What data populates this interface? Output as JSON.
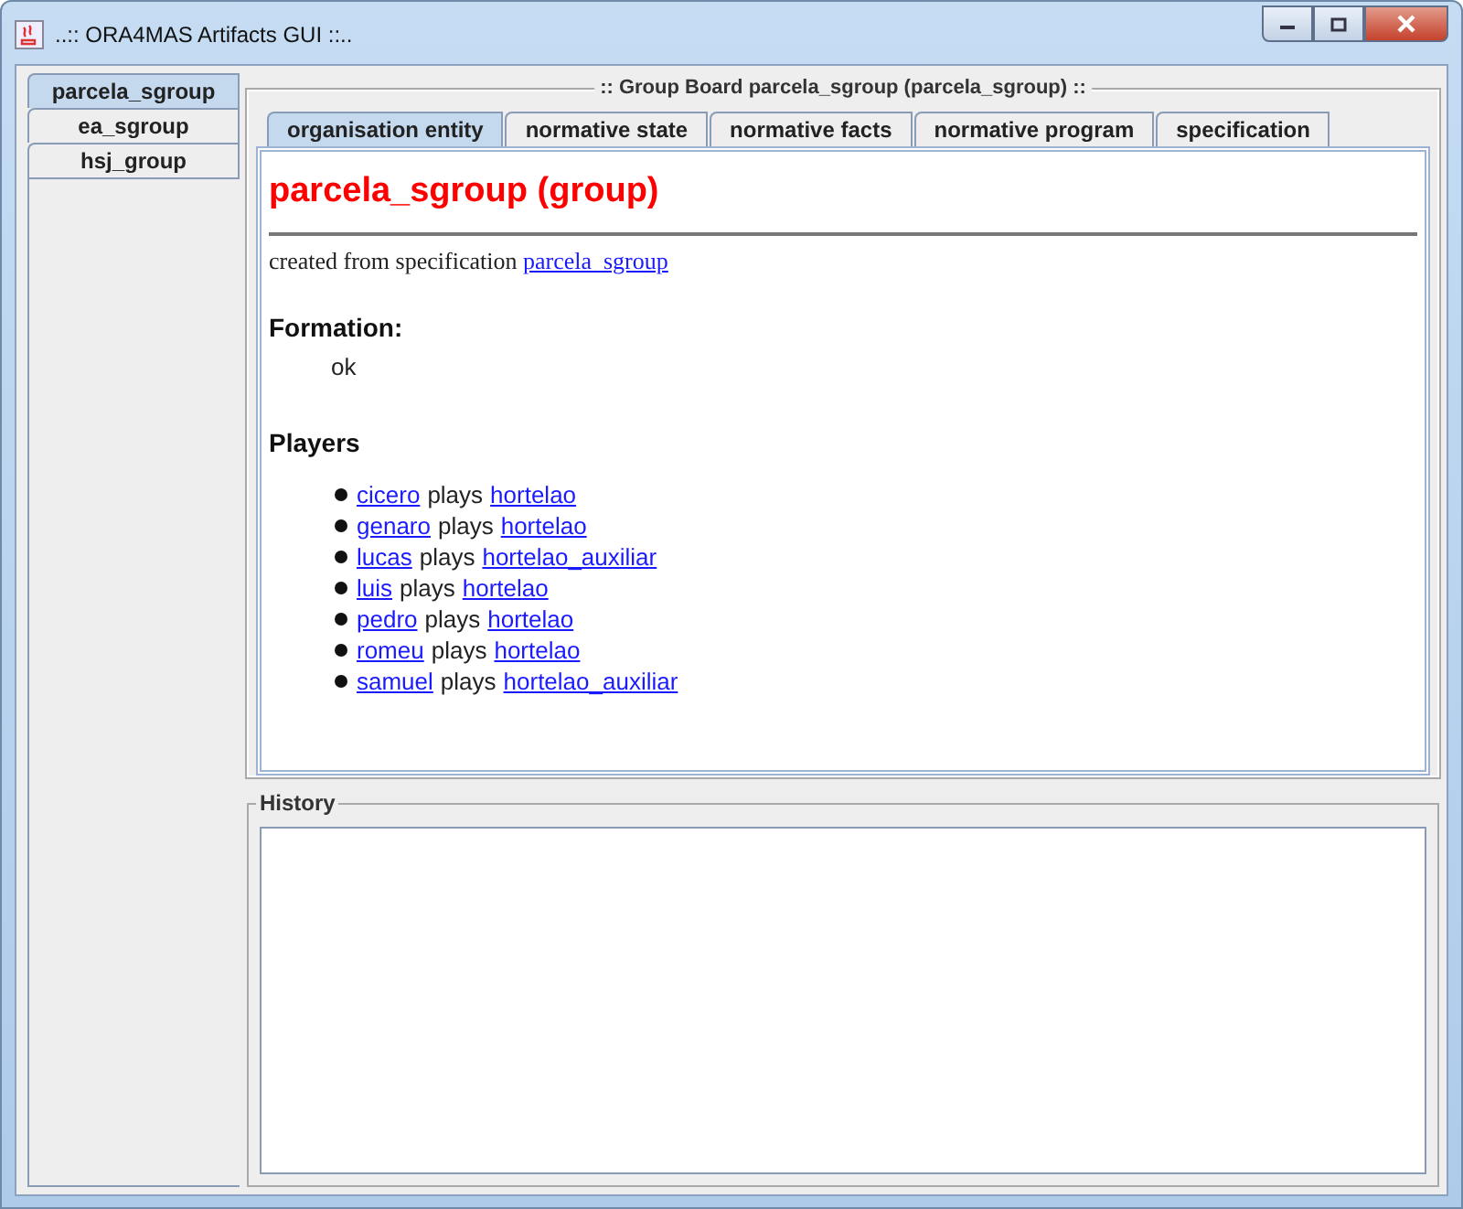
{
  "window": {
    "title": "..:: ORA4MAS Artifacts GUI ::.."
  },
  "sidebar": {
    "tabs": [
      {
        "label": "parcela_sgroup",
        "selected": true
      },
      {
        "label": "ea_sgroup",
        "selected": false
      },
      {
        "label": "hsj_group",
        "selected": false
      }
    ]
  },
  "board": {
    "title": ":: Group Board parcela_sgroup (parcela_sgroup) ::",
    "tabs": [
      {
        "label": "organisation entity",
        "selected": true
      },
      {
        "label": "normative state",
        "selected": false
      },
      {
        "label": "normative facts",
        "selected": false
      },
      {
        "label": "normative program",
        "selected": false
      },
      {
        "label": "specification",
        "selected": false
      }
    ],
    "heading": "parcela_sgroup (group)",
    "spec_text": "created from specification",
    "spec_link": "parcela_sgroup",
    "formation_heading": "Formation:",
    "formation_value": "ok",
    "players_heading": "Players",
    "players": [
      {
        "agent": "cicero",
        "verb": "plays",
        "role": "hortelao"
      },
      {
        "agent": "genaro",
        "verb": "plays",
        "role": "hortelao"
      },
      {
        "agent": "lucas",
        "verb": "plays",
        "role": "hortelao_auxiliar"
      },
      {
        "agent": "luis",
        "verb": "plays",
        "role": "hortelao"
      },
      {
        "agent": "pedro",
        "verb": "plays",
        "role": "hortelao"
      },
      {
        "agent": "romeu",
        "verb": "plays",
        "role": "hortelao"
      },
      {
        "agent": "samuel",
        "verb": "plays",
        "role": "hortelao_auxiliar"
      }
    ]
  },
  "history": {
    "title": "History"
  }
}
